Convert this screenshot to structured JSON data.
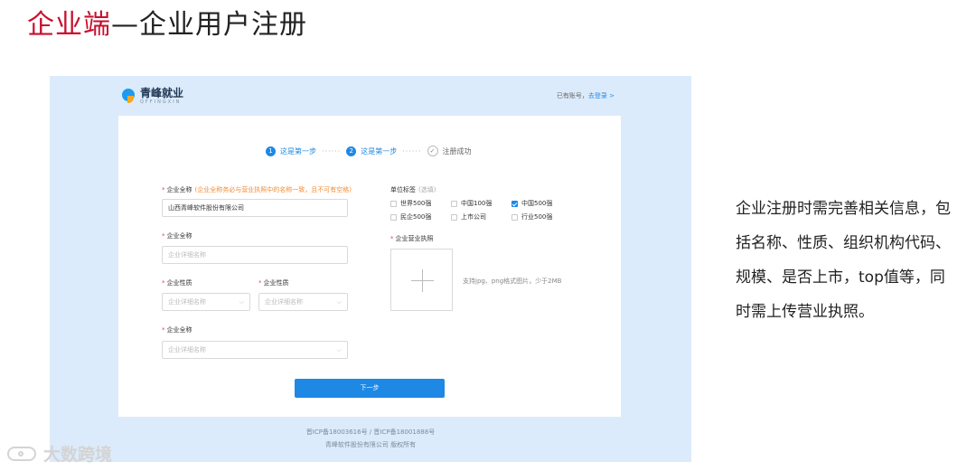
{
  "slide": {
    "title_accent": "企业端",
    "title_rest": "—企业用户注册",
    "description": "企业注册时需完善相关信息，包括名称、性质、组织机构代码、规模、是否上市，top值等，同时需上传营业执照。",
    "watermark": "大数跨境"
  },
  "colors": {
    "accent": "#c8102e",
    "primary": "#1e88e5",
    "panel_bg": "#dcebfb"
  },
  "header": {
    "logo_name": "青峰就业",
    "logo_sub": "QFFINGXIN",
    "login_prompt": "已有账号，",
    "login_link": "去登录 >"
  },
  "steps": [
    {
      "num": "1",
      "label": "这是第一步"
    },
    {
      "num": "2",
      "label": "这是第一步"
    },
    {
      "num": "✓",
      "label": "注册成功"
    }
  ],
  "step_separator": "······",
  "form": {
    "company_name_label": "企业全称",
    "company_name_hint": "(企业全称务必与营业执照中的名称一致，且不可有空格)",
    "company_name_value": "山西青峰软件股份有限公司",
    "company_fullname2_label": "企业全称",
    "company_fullname2_placeholder": "企业详细名称",
    "nature1_label": "企业性质",
    "nature1_placeholder": "企业详细名称",
    "nature2_label": "企业性质",
    "nature2_placeholder": "企业详细名称",
    "company_fullname3_label": "企业全称",
    "company_fullname3_placeholder": "企业详细名称",
    "tags_label": "单位标签",
    "tags_optional": "(选填)",
    "tags_row1": [
      {
        "label": "世界500强",
        "checked": false
      },
      {
        "label": "中国100强",
        "checked": false
      },
      {
        "label": "中国500强",
        "checked": true
      }
    ],
    "tags_row2": [
      {
        "label": "民企500强",
        "checked": false
      },
      {
        "label": "上市公司",
        "checked": false
      },
      {
        "label": "行业500强",
        "checked": false
      }
    ],
    "license_label": "企业营业执照",
    "license_hint": "支持jpg、png格式图片，少于2MB",
    "next_button": "下一步",
    "required_mark": "*",
    "chevron": "⌵"
  },
  "footer": {
    "icp": "晋ICP备18003616号 / 晋ICP备18001888号",
    "copyright": "青峰软件股份有限公司 版权所有"
  }
}
